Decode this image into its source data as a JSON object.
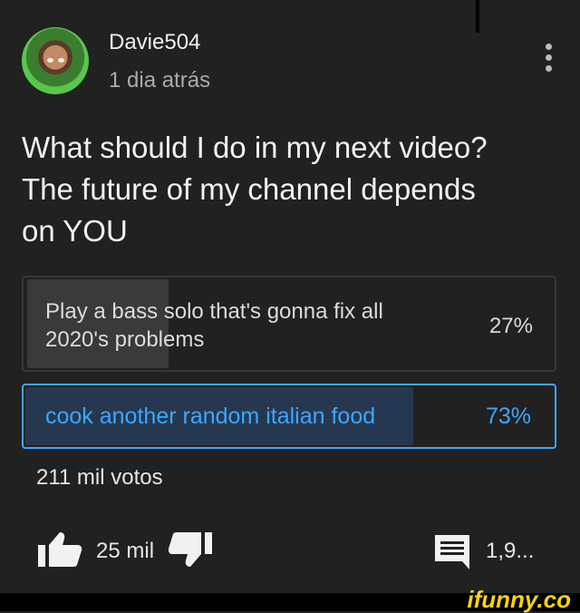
{
  "post": {
    "author": "Davie504",
    "time": "1 dia atrás",
    "question": "What should I do in my next video?\nThe future of my channel depends\non YOU",
    "options": [
      {
        "label": "Play a bass solo that's gonna fix all 2020's problems",
        "percent": "27%",
        "selected": false
      },
      {
        "label": "cook another random italian food",
        "percent": "73%",
        "selected": true
      }
    ],
    "votes": "211 mil votos",
    "likes": "25 mil",
    "comments": "1,9..."
  },
  "watermark": {
    "text": "ifunny.co",
    "color": "#ffd400"
  },
  "icons": {
    "avatar": "avatar",
    "menu": "more-vert-icon",
    "like": "thumb-up-icon",
    "dislike": "thumb-down-icon",
    "comment": "comment-icon"
  },
  "colors": {
    "background": "#212121",
    "accent": "#3ea6ff"
  }
}
